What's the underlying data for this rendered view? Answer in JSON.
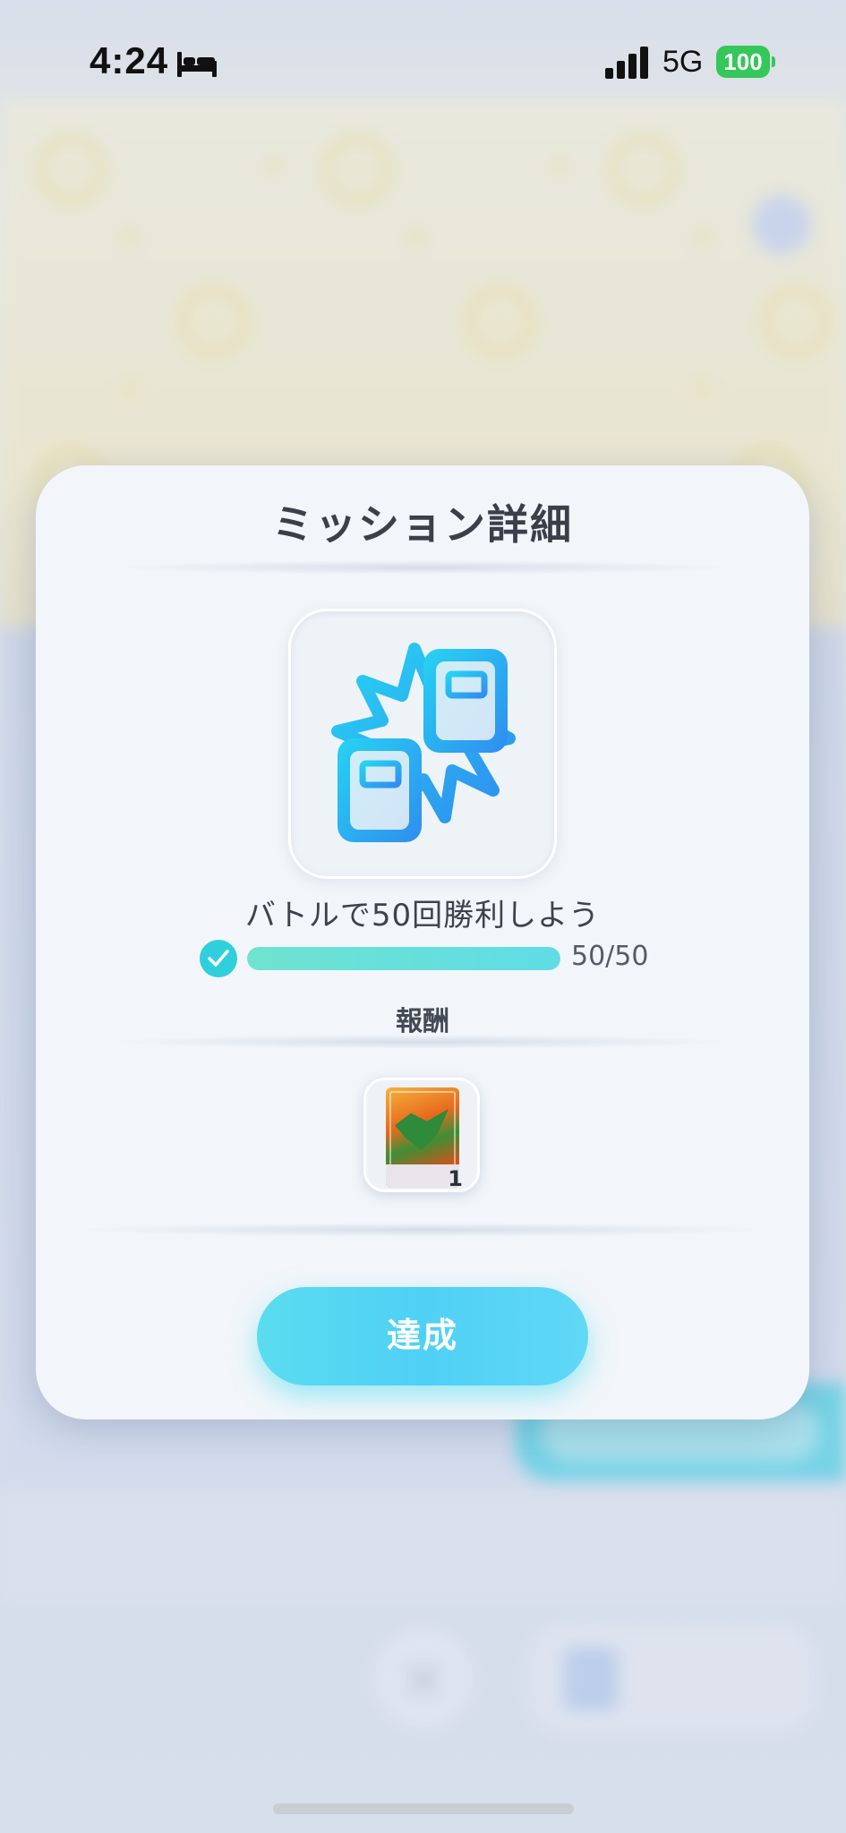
{
  "status_bar": {
    "time": "4:24",
    "network": "5G",
    "battery": "100",
    "icons": [
      "bed-icon",
      "signal-bars-icon"
    ]
  },
  "modal": {
    "title": "ミッション詳細",
    "mission": {
      "icon": "battle-cards-icon",
      "description": "バトルで50回勝利しよう",
      "progress_current": 50,
      "progress_total": 50,
      "progress_text": "50/50",
      "completed": true
    },
    "reward": {
      "label": "報酬",
      "item": "card",
      "quantity": "1"
    },
    "action_button": "達成"
  },
  "colors": {
    "accent": "#4fd0f5",
    "progress": "#5fdce6",
    "check": "#2fd0dc",
    "battery": "#34c759"
  }
}
